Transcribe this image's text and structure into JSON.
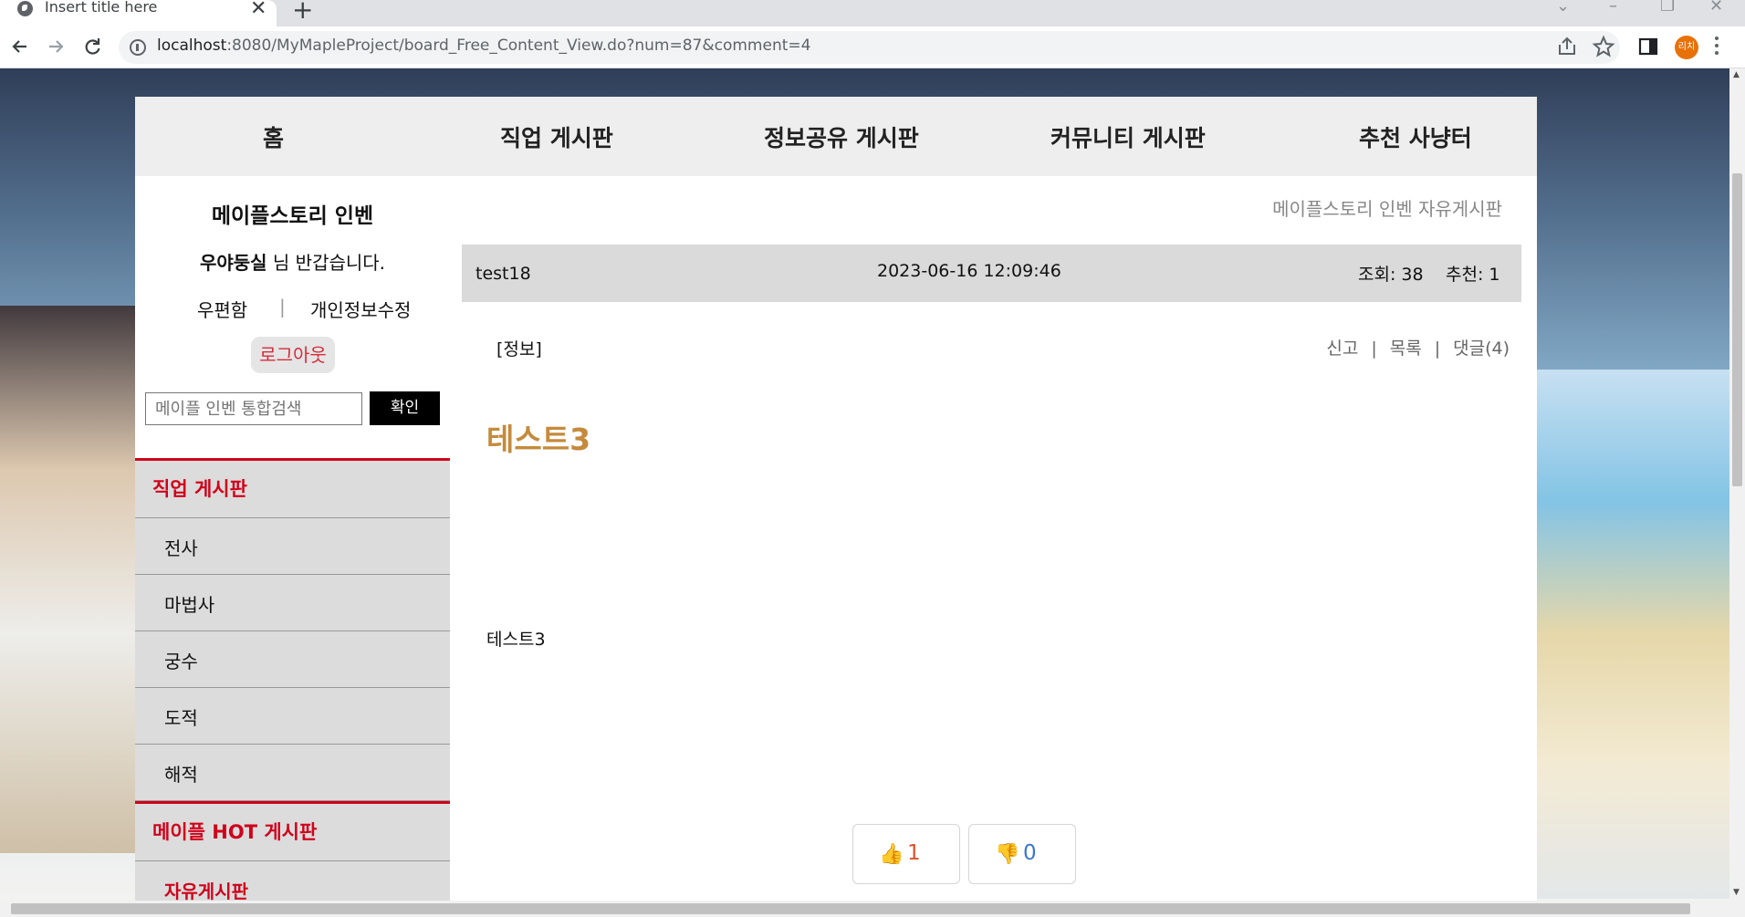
{
  "browser": {
    "tab_title": "Insert title here",
    "url_host": "localhost",
    "url_rest": ":8080/MyMapleProject/board_Free_Content_View.do?num=87&comment=4",
    "profile_initials": "리치",
    "new_tab_glyph": "+",
    "close_glyph": "✕"
  },
  "nav": {
    "home": "홈",
    "job_board": "직업 게시판",
    "info_board": "정보공유 게시판",
    "community_board": "커뮤니티 게시판",
    "hunting_board": "추천 사냥터"
  },
  "sidebar": {
    "site_title": "메이플스토리 인벤",
    "username": "우야둥실",
    "greeting_suffix": " 님 반갑습니다.",
    "mailbox": "우편함",
    "separator": "|",
    "edit_profile": "개인정보수정",
    "logout": "로그아웃",
    "search_placeholder": "메이플 인벤 통합검색",
    "search_button": "확인",
    "job_section": "직업 게시판",
    "jobs": [
      "전사",
      "마법사",
      "궁수",
      "도적",
      "해적"
    ],
    "hot_section": "메이플 HOT 게시판",
    "free_board": "자유게시판"
  },
  "post": {
    "board_name": "메이플스토리 인벤 자유게시판",
    "author": "test18",
    "date": "2023-06-16 12:09:46",
    "views": "조회: 38",
    "recommends": "추천: 1",
    "category": "[정보]",
    "report": "신고",
    "list": "목록",
    "comments": "댓글(4)",
    "title": "테스트3",
    "body": "테스트3",
    "upvotes": "1",
    "downvotes": "0",
    "upvote_icon": "👍",
    "downvote_icon": "👎"
  },
  "colors": {
    "accent_red": "#d0021b",
    "title_gold": "#c58a3c",
    "upvote_count": "#d9532c",
    "downvote_count": "#3b78c8"
  }
}
